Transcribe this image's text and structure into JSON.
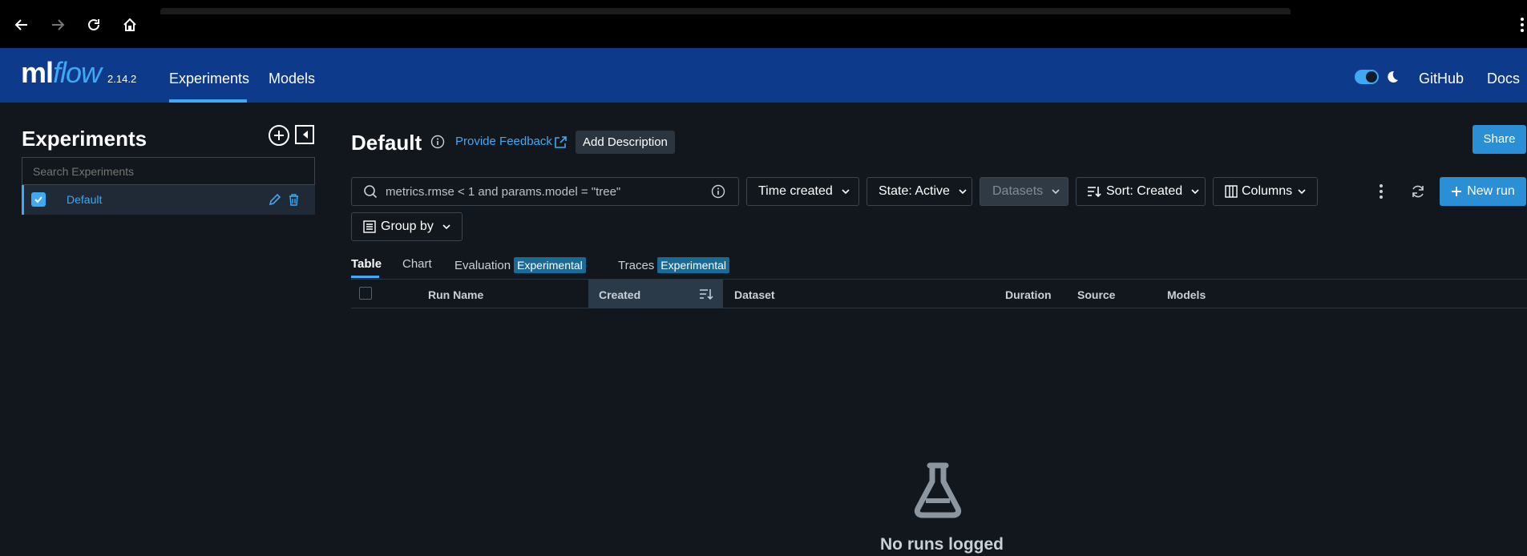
{
  "browser": {
    "icons": [
      "back-arrow-icon",
      "forward-arrow-icon",
      "reload-icon",
      "home-icon",
      "kebab-menu-icon"
    ]
  },
  "header": {
    "logo_ml": "ml",
    "logo_flow": "flow",
    "version": "2.14.2",
    "nav": [
      {
        "label": "Experiments",
        "active": true
      },
      {
        "label": "Models",
        "active": false
      }
    ],
    "links": {
      "github": "GitHub",
      "docs": "Docs"
    },
    "dark_mode": true,
    "colors": {
      "bg": "#0d3a8a",
      "accent": "#3fa9f5"
    }
  },
  "sidebar": {
    "title": "Experiments",
    "search_placeholder": "Search Experiments",
    "experiments": [
      {
        "name": "Default",
        "checked": true
      }
    ]
  },
  "main": {
    "title": "Default",
    "feedback_label": "Provide Feedback",
    "add_description_label": "Add Description",
    "share_label": "Share",
    "search_placeholder": "metrics.rmse < 1 and params.model = \"tree\"",
    "controls": {
      "time_created": "Time created",
      "state": "State: Active",
      "datasets": "Datasets",
      "sort": "Sort: Created",
      "columns": "Columns",
      "group_by": "Group by",
      "new_run": "New run"
    },
    "tabs": {
      "table": "Table",
      "chart": "Chart",
      "evaluation": "Evaluation",
      "traces": "Traces",
      "badge": "Experimental",
      "active": "Table"
    },
    "columns": [
      "Run Name",
      "Created",
      "Dataset",
      "Duration",
      "Source",
      "Models"
    ],
    "sorted_column": "Created",
    "empty_message": "No runs logged"
  }
}
